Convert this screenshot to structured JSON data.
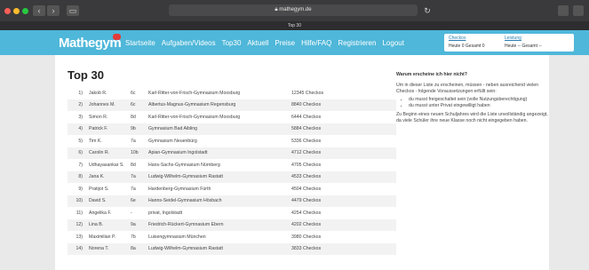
{
  "browser": {
    "url": "mathegym.de",
    "tab_title": "Top 30"
  },
  "site": {
    "logo": "Mathegym",
    "nav": [
      "Startseite",
      "Aufgaben/Videos",
      "Top30",
      "Aktuell",
      "Preise",
      "Hilfe/FAQ",
      "Registrieren",
      "Logout"
    ],
    "stats": {
      "checkos_label": "Checkos",
      "checkos_value": "Heute 0 Gesamt 0",
      "leistung_label": "Leistung",
      "leistung_value": "Heute --  Gesamt --"
    }
  },
  "page": {
    "title": "Top 30",
    "rows": [
      {
        "rank": "1)",
        "name": "Jakob R.",
        "class": "6c",
        "school": "Karl-Ritter-von-Frisch-Gymnasium Moosburg",
        "checkos": "12345 Checkos"
      },
      {
        "rank": "2)",
        "name": "Johannes M.",
        "class": "6c",
        "school": "Albertus-Magnus-Gymnasium Regensburg",
        "checkos": "8840 Checkos"
      },
      {
        "rank": "3)",
        "name": "Simon R.",
        "class": "8d",
        "school": "Karl-Ritter-von-Frisch-Gymnasium Moosburg",
        "checkos": "6444 Checkos"
      },
      {
        "rank": "4)",
        "name": "Patrick F.",
        "class": "9b",
        "school": "Gymnasium Bad Aibling",
        "checkos": "5884 Checkos"
      },
      {
        "rank": "5)",
        "name": "Tim K.",
        "class": "7a",
        "school": "Gymnasium Neuenbürg",
        "checkos": "5336 Checkos"
      },
      {
        "rank": "6)",
        "name": "Carolin R.",
        "class": "10b",
        "school": "Apian-Gymnasium Ingolstadt",
        "checkos": "4712 Checkos"
      },
      {
        "rank": "7)",
        "name": "Udhayasankar S.",
        "class": "8d",
        "school": "Hans-Sachs-Gymnasium Nürnberg",
        "checkos": "4705 Checkos"
      },
      {
        "rank": "8)",
        "name": "Jana K.",
        "class": "7a",
        "school": "Ludwig-Wilhelm-Gymnasium Rastatt",
        "checkos": "4533 Checkos"
      },
      {
        "rank": "9)",
        "name": "Pratijot S.",
        "class": "7a",
        "school": "Hardenberg-Gymnasium Fürth",
        "checkos": "4504 Checkos"
      },
      {
        "rank": "10)",
        "name": "David S.",
        "class": "6e",
        "school": "Hanns-Seidel-Gymnasium Hösbach",
        "checkos": "4479 Checkos"
      },
      {
        "rank": "11)",
        "name": "Angelika F.",
        "class": "-",
        "school": "privat, Ingolstadt",
        "checkos": "4254 Checkos"
      },
      {
        "rank": "12)",
        "name": "Lina B.",
        "class": "9a",
        "school": "Friedrich-Rückert-Gymnasium Ebern",
        "checkos": "4202 Checkos"
      },
      {
        "rank": "13)",
        "name": "Maximilian P.",
        "class": "7b",
        "school": "Luisengymnasium München",
        "checkos": "3980 Checkos"
      },
      {
        "rank": "14)",
        "name": "Norena T.",
        "class": "8a",
        "school": "Ludwig-Wilhelm-Gymnasium Rastatt",
        "checkos": "3833 Checkos"
      }
    ]
  },
  "sidebar": {
    "title": "Warum erscheine ich hier nicht?",
    "intro": "Um in dieser Liste zu erscheinen, müssen - neben ausreichend vielen Checkos - folgende Voraussetzungen erfüllt sein:",
    "bullets": [
      "du musst freigeschaltet sein (volle Nutzungsberechtigung)",
      "du musst unter Privat eingewilligt haben"
    ],
    "note": "Zu Beginn eines neuen Schuljahres wird die Liste unvollständig angezeigt, da viele Schüler ihre neue Klasse noch nicht eingegeben haben."
  }
}
